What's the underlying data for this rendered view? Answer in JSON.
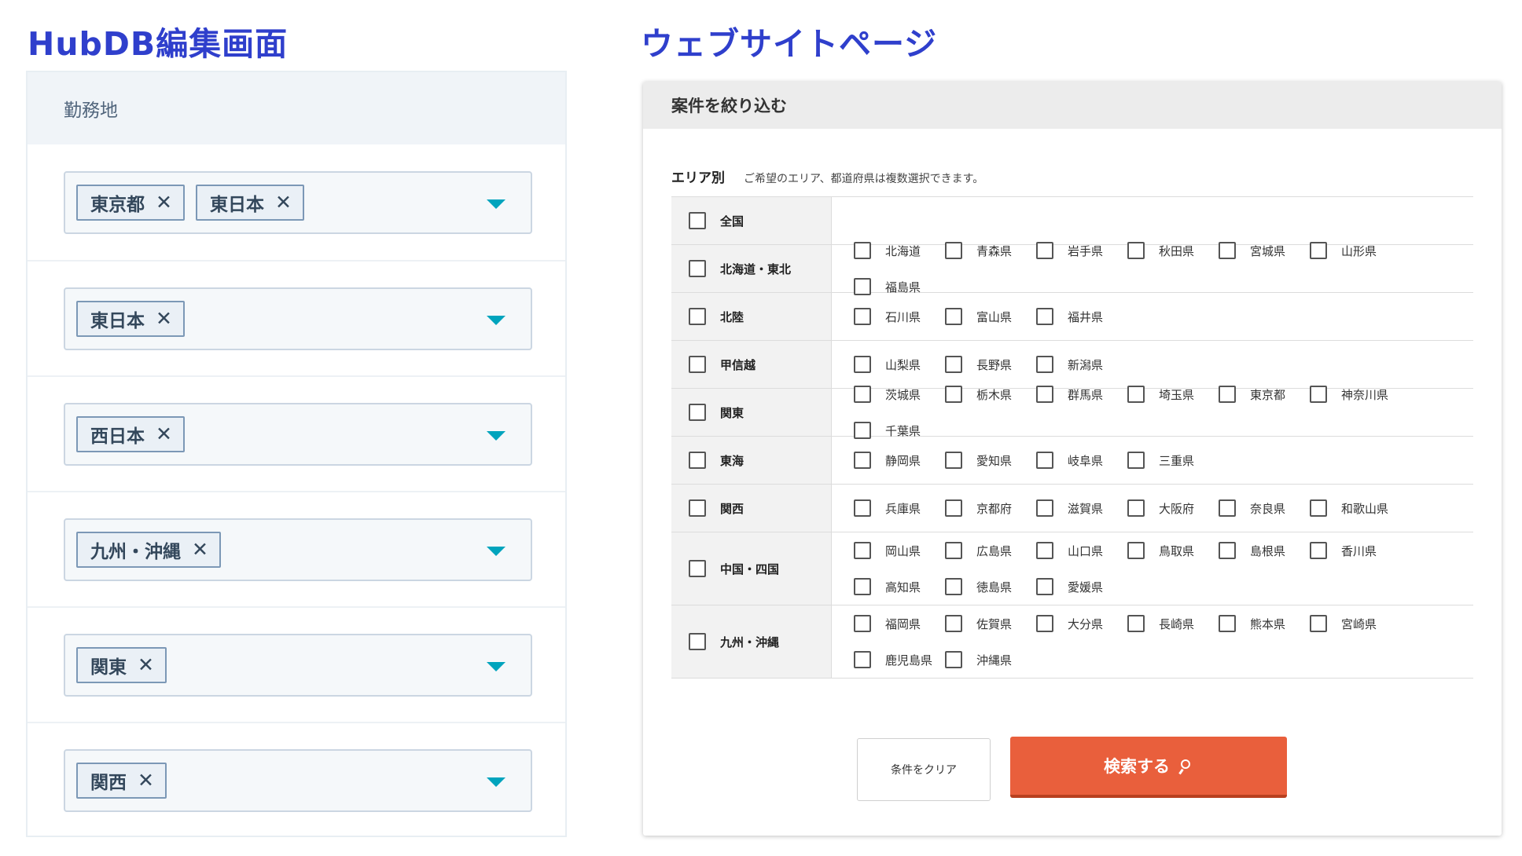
{
  "headings": {
    "left": "HubDB編集画面",
    "right": "ウェブサイトページ"
  },
  "hubdb": {
    "column_header": "勤務地",
    "rows": [
      {
        "tags": [
          "東京都",
          "東日本"
        ]
      },
      {
        "tags": [
          "東日本"
        ]
      },
      {
        "tags": [
          "西日本"
        ]
      },
      {
        "tags": [
          "九州・沖縄"
        ]
      },
      {
        "tags": [
          "関東"
        ]
      },
      {
        "tags": [
          "関西"
        ]
      }
    ],
    "remove_glyph": "✕",
    "accent_color": "#00a4bd"
  },
  "website": {
    "panel_title": "案件を絞り込む",
    "area_title": "エリア別",
    "area_note": "ご希望のエリア、都道府県は複数選択できます。",
    "regions": [
      {
        "name": "全国",
        "prefectures": []
      },
      {
        "name": "北海道・東北",
        "prefectures": [
          "北海道",
          "青森県",
          "岩手県",
          "秋田県",
          "宮城県",
          "山形県",
          "福島県"
        ]
      },
      {
        "name": "北陸",
        "prefectures": [
          "石川県",
          "富山県",
          "福井県"
        ]
      },
      {
        "name": "甲信越",
        "prefectures": [
          "山梨県",
          "長野県",
          "新潟県"
        ]
      },
      {
        "name": "関東",
        "prefectures": [
          "茨城県",
          "栃木県",
          "群馬県",
          "埼玉県",
          "東京都",
          "神奈川県",
          "千葉県"
        ]
      },
      {
        "name": "東海",
        "prefectures": [
          "静岡県",
          "愛知県",
          "岐阜県",
          "三重県"
        ]
      },
      {
        "name": "関西",
        "prefectures": [
          "兵庫県",
          "京都府",
          "滋賀県",
          "大阪府",
          "奈良県",
          "和歌山県"
        ]
      },
      {
        "name": "中国・四国",
        "prefectures": [
          "岡山県",
          "広島県",
          "山口県",
          "鳥取県",
          "島根県",
          "香川県",
          "高知県",
          "徳島県",
          "愛媛県"
        ]
      },
      {
        "name": "九州・沖縄",
        "prefectures": [
          "福岡県",
          "佐賀県",
          "大分県",
          "長崎県",
          "熊本県",
          "宮崎県",
          "鹿児島県",
          "沖縄県"
        ]
      }
    ],
    "clear_button": "条件をクリア",
    "search_button": "検索する",
    "search_button_color": "#e95f3c"
  }
}
